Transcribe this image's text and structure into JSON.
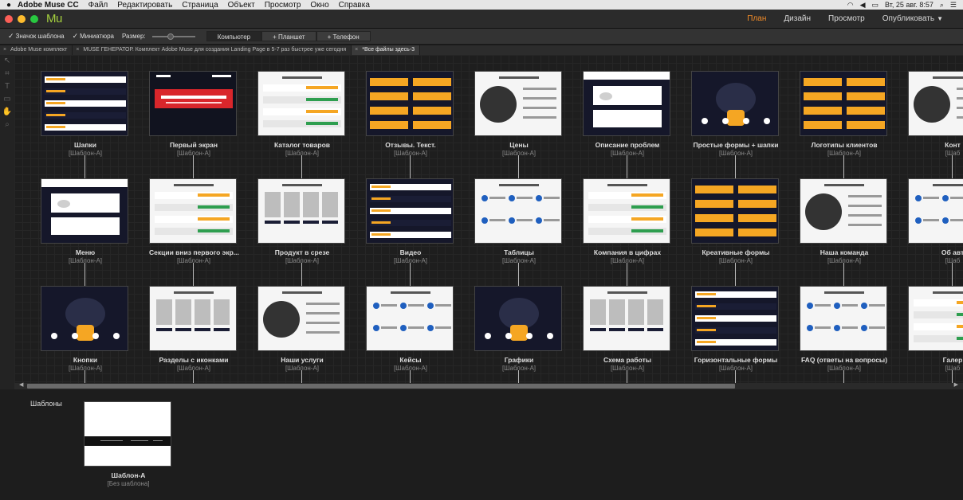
{
  "menubar": {
    "apple": "",
    "app_name": "Adobe Muse CC",
    "items": [
      "Файл",
      "Редактировать",
      "Страница",
      "Объект",
      "Просмотр",
      "Окно",
      "Справка"
    ],
    "clock": "Вт, 25 авг.  8:57"
  },
  "titlebar": {
    "logo": "Mu",
    "modes": [
      {
        "label": "План",
        "active": true
      },
      {
        "label": "Дизайн",
        "active": false
      },
      {
        "label": "Просмотр",
        "active": false
      },
      {
        "label": "Опубликовать",
        "active": false
      }
    ]
  },
  "options": {
    "template_badge": "Значок шаблона",
    "thumbnails": "Миниатюра",
    "size_label": "Размер:",
    "device_tabs": [
      {
        "label": "Компьютер",
        "active": true
      },
      {
        "label": "+ Планшет",
        "active": false
      },
      {
        "label": "+ Телефон",
        "active": false
      }
    ]
  },
  "doc_tabs": [
    {
      "label": "Adobe Muse комплект",
      "active": false
    },
    {
      "label": "MUSE ГЕНЕРАТОР. Комплект Adobe Muse для создания Landing Page в 5-7 раз быстрее уже сегодня",
      "active": false
    },
    {
      "label": "*Все файлы здесь-3",
      "active": true
    }
  ],
  "pages": [
    [
      {
        "name": "Шапки",
        "master": "[Шаблон-А]",
        "style": "dark"
      },
      {
        "name": "Первый экран",
        "master": "[Шаблон-А]",
        "style": "hero"
      },
      {
        "name": "Каталог товаров",
        "master": "[Шаблон-А]",
        "style": "light"
      },
      {
        "name": "Отзывы. Текст.",
        "master": "[Шаблон-А]",
        "style": "dark"
      },
      {
        "name": "Цены",
        "master": "[Шаблон-А]",
        "style": "light"
      },
      {
        "name": "Описание проблем",
        "master": "[Шаблон-А]",
        "style": "dark"
      },
      {
        "name": "Простые формы + шапки",
        "master": "[Шаблон-А]",
        "style": "dark"
      },
      {
        "name": "Логотипы клиентов",
        "master": "[Шаблон-А]",
        "style": "dark"
      },
      {
        "name": "Конт",
        "master": "[Шаб",
        "style": "light"
      }
    ],
    [
      {
        "name": "Меню",
        "master": "[Шаблон-А]",
        "style": "dark"
      },
      {
        "name": "Секции вниз первого экр...",
        "master": "[Шаблон-А]",
        "style": "light"
      },
      {
        "name": "Продукт в срезе",
        "master": "[Шаблон-А]",
        "style": "light"
      },
      {
        "name": "Видео",
        "master": "[Шаблон-А]",
        "style": "dark"
      },
      {
        "name": "Таблицы",
        "master": "[Шаблон-А]",
        "style": "light"
      },
      {
        "name": "Компания в цифрах",
        "master": "[Шаблон-А]",
        "style": "light"
      },
      {
        "name": "Креативные формы",
        "master": "[Шаблон-А]",
        "style": "dark"
      },
      {
        "name": "Наша команда",
        "master": "[Шаблон-А]",
        "style": "light"
      },
      {
        "name": "Об авт",
        "master": "[Шаб",
        "style": "light"
      }
    ],
    [
      {
        "name": "Кнопки",
        "master": "[Шаблон-А]",
        "style": "dark"
      },
      {
        "name": "Разделы с иконками",
        "master": "[Шаблон-А]",
        "style": "light"
      },
      {
        "name": "Наши услуги",
        "master": "[Шаблон-А]",
        "style": "light"
      },
      {
        "name": "Кейсы",
        "master": "[Шаблон-А]",
        "style": "light"
      },
      {
        "name": "Графики",
        "master": "[Шаблон-А]",
        "style": "dark"
      },
      {
        "name": "Схема работы",
        "master": "[Шаблон-А]",
        "style": "light"
      },
      {
        "name": "Горизонтальные формы",
        "master": "[Шаблон-А]",
        "style": "dark"
      },
      {
        "name": "FAQ (ответы на вопросы)",
        "master": "[Шаблон-А]",
        "style": "light"
      },
      {
        "name": "Галер",
        "master": "[Шаб",
        "style": "light"
      }
    ]
  ],
  "masters": {
    "title": "Шаблоны",
    "items": [
      {
        "name": "Шаблон-А",
        "master": "[Без шаблона]"
      }
    ]
  },
  "colors": {
    "accent": "#f28c28",
    "logo": "#a4cf3e",
    "thumb_orange": "#f5a623",
    "thumb_navy": "#15172a"
  }
}
